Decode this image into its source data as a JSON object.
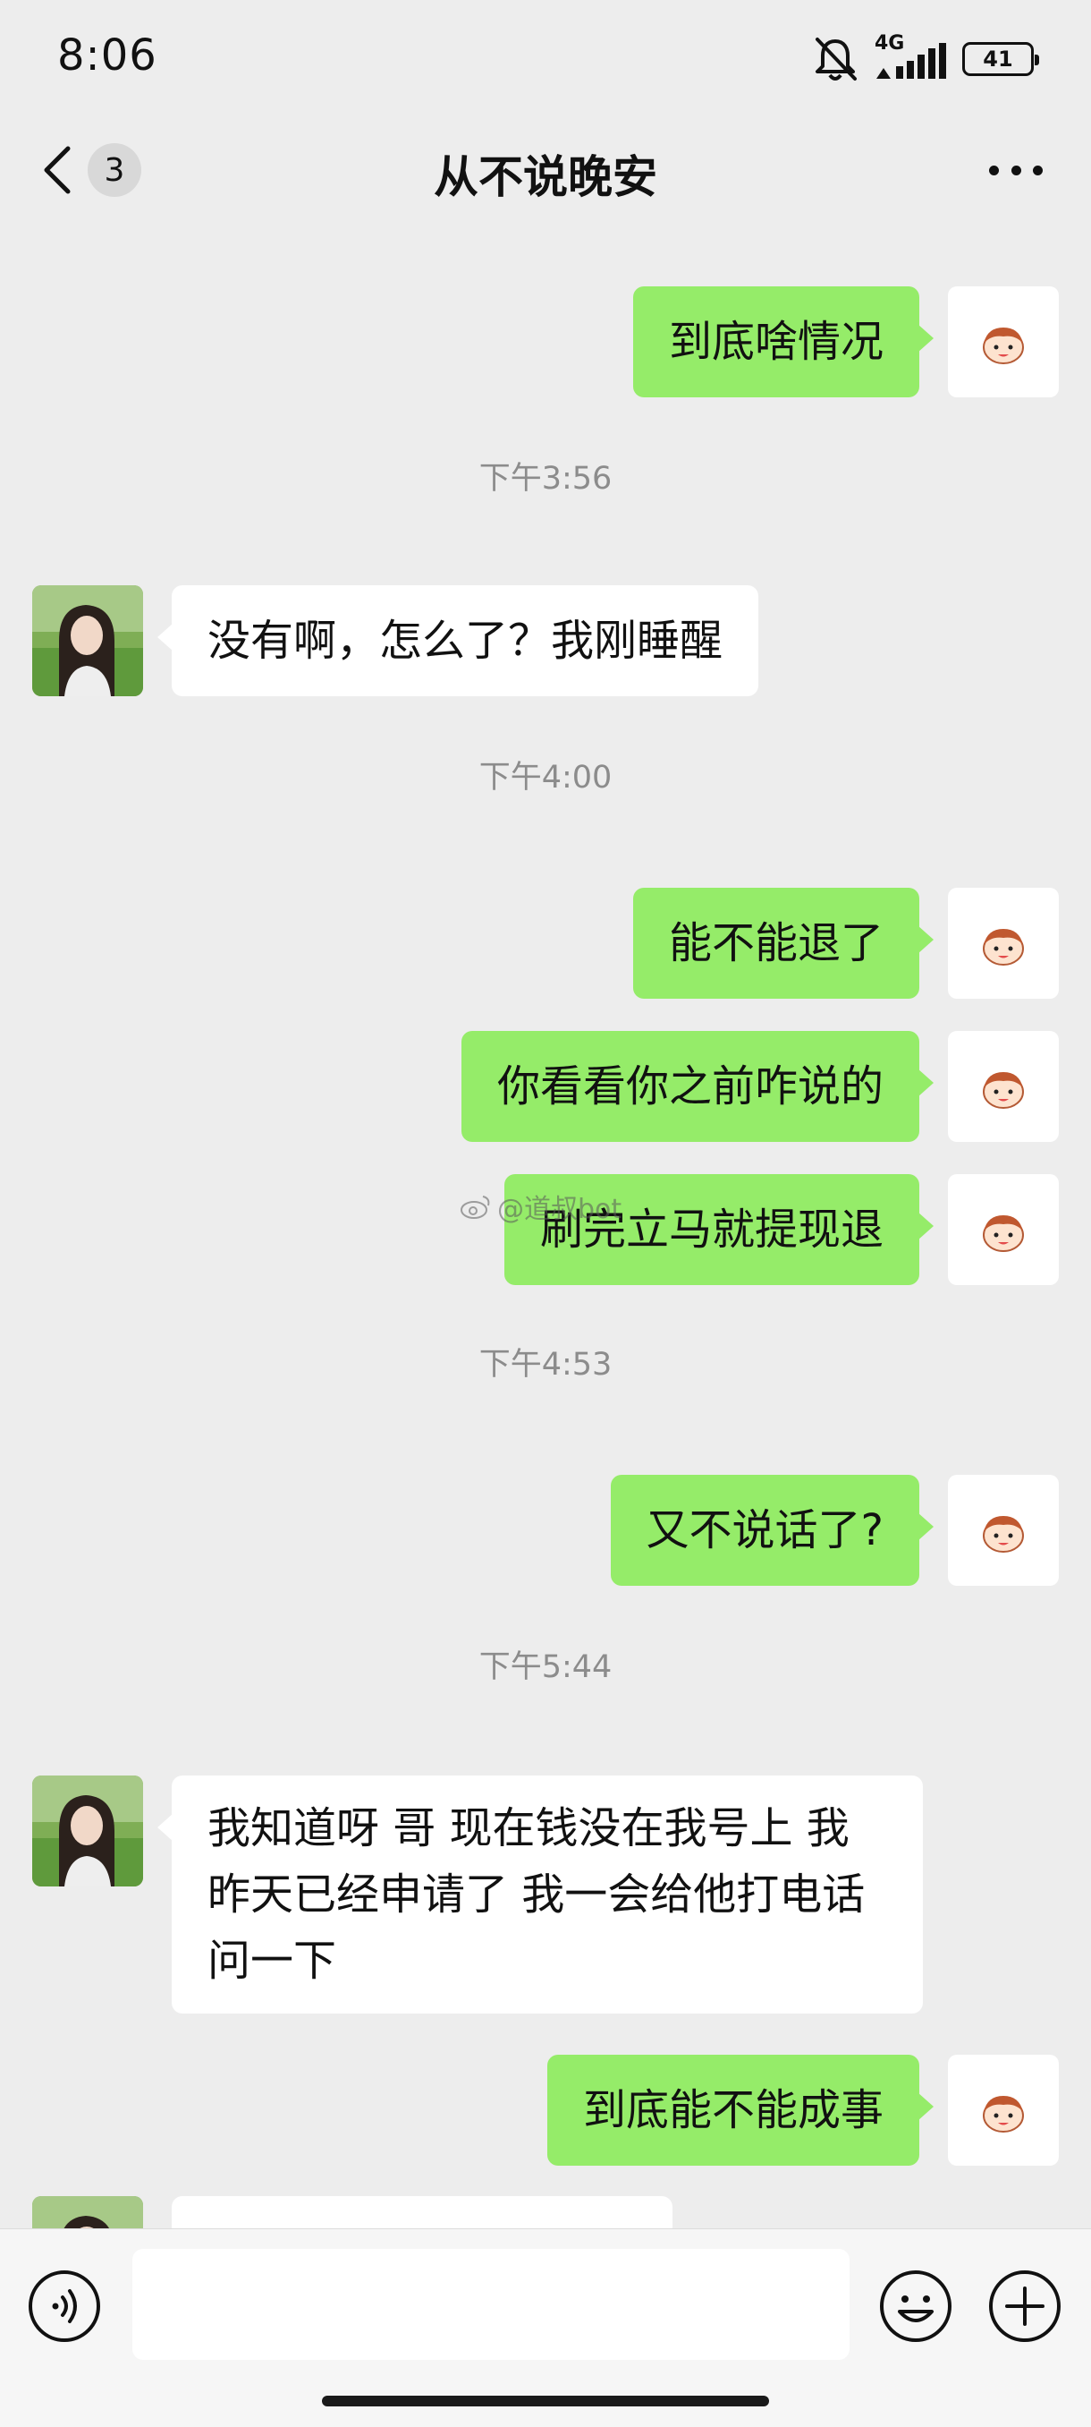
{
  "status_bar": {
    "time": "8:06",
    "network": "4G",
    "battery": "41",
    "icons": [
      "bell-muted-icon",
      "signal-icon",
      "battery-icon"
    ]
  },
  "nav": {
    "unread_count": "3",
    "title": "从不说晚安",
    "icons": [
      "chevron-left-icon",
      "more-icon"
    ]
  },
  "messages": [
    {
      "sender": "me",
      "text": "到底啥情况"
    },
    {
      "type": "time",
      "text": "下午3:56"
    },
    {
      "sender": "other",
      "text": "没有啊，怎么了？我刚睡醒"
    },
    {
      "type": "time",
      "text": "下午4:00"
    },
    {
      "sender": "me",
      "text": "能不能退了"
    },
    {
      "sender": "me",
      "text": "你看看你之前咋说的"
    },
    {
      "sender": "me",
      "text": "刷完立马就提现退"
    },
    {
      "type": "time",
      "text": "下午4:53"
    },
    {
      "sender": "me",
      "text": "又不说话了?"
    },
    {
      "type": "time",
      "text": "下午5:44"
    },
    {
      "sender": "other",
      "text": "我知道呀  哥 现在钱没在我号上 我昨天已经申请了 我一会给他打电话问一下"
    },
    {
      "sender": "me",
      "text": "到底能不能成事"
    }
  ],
  "watermark": "@道叔bot",
  "input_bar": {
    "icons": [
      "voice-icon",
      "emoji-icon",
      "plus-icon"
    ]
  },
  "colors": {
    "background": "#ededed",
    "my_bubble": "#95ec69",
    "their_bubble": "#ffffff"
  }
}
